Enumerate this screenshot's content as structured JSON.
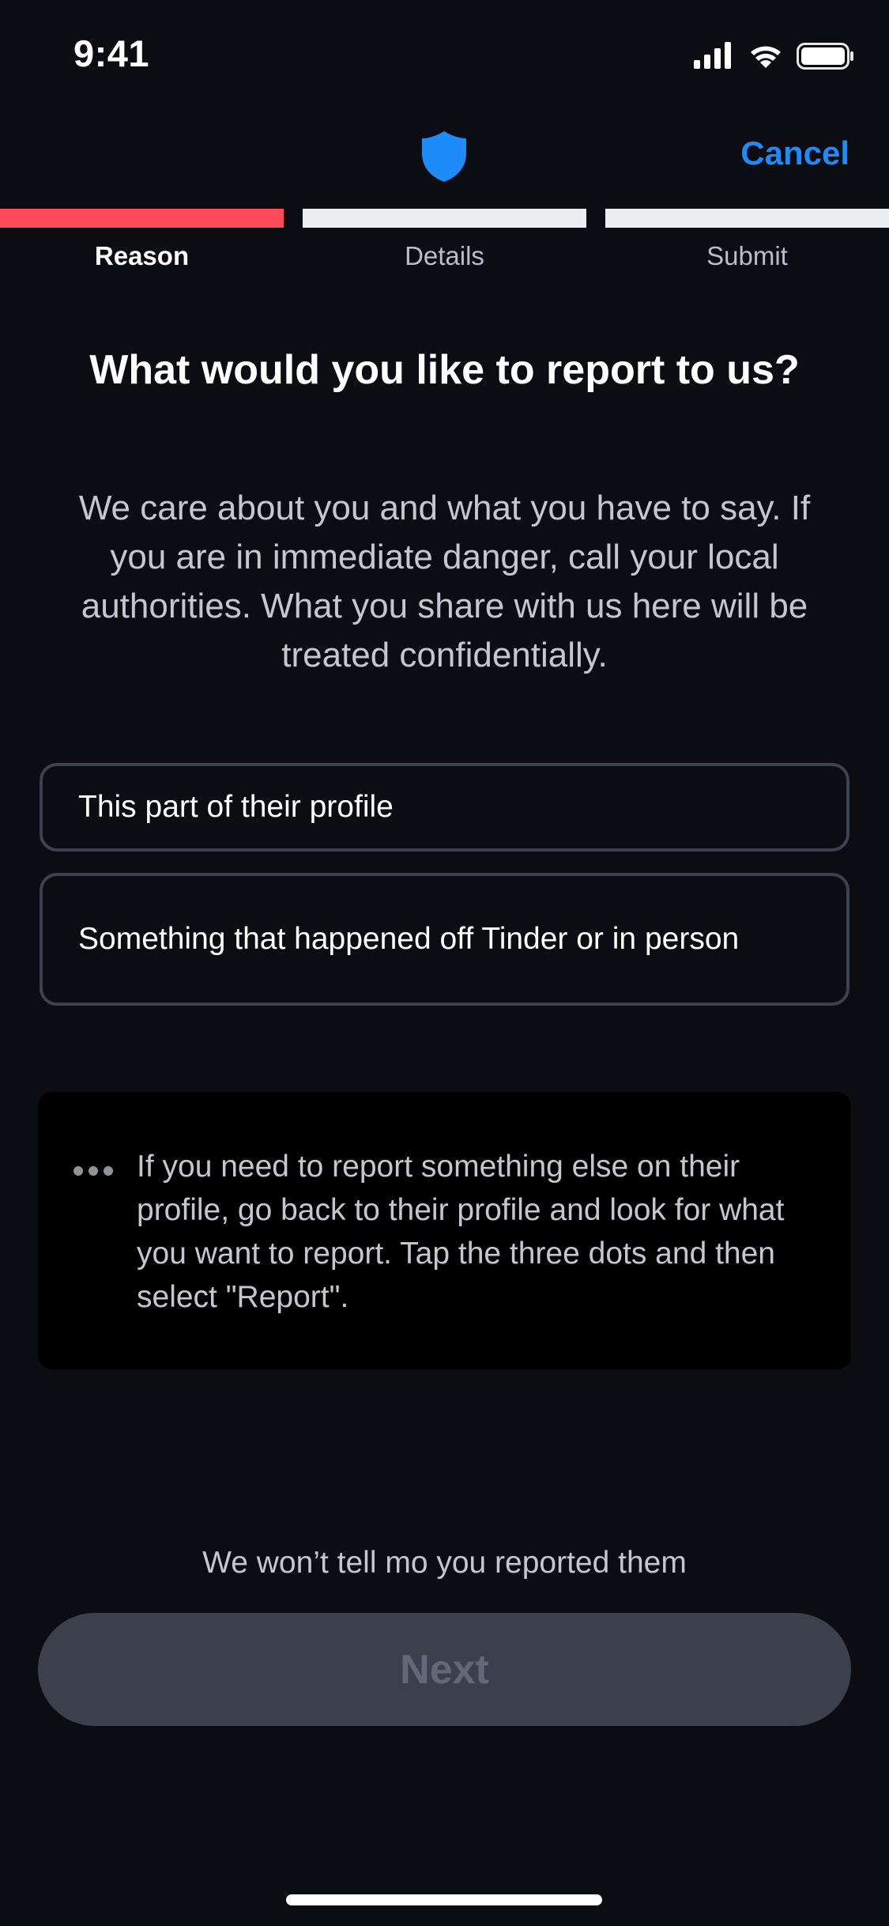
{
  "status_bar": {
    "time": "9:41",
    "icons": [
      "cellular-signal-icon",
      "wifi-icon",
      "battery-icon"
    ]
  },
  "header": {
    "icon": "shield-icon",
    "cancel_label": "Cancel"
  },
  "progress": {
    "steps": [
      {
        "label": "Reason",
        "active": true
      },
      {
        "label": "Details",
        "active": false
      },
      {
        "label": "Submit",
        "active": false
      }
    ]
  },
  "content": {
    "title": "What would you like to report to us?",
    "description": "We care about you and what you have to say. If you are in immediate danger, call your local authorities. What you share with us here will be treated confidentially.",
    "options": [
      {
        "label": "This part of their profile"
      },
      {
        "label": "Something that happened off Tinder or in person"
      }
    ],
    "info": {
      "icon": "more-dots-icon",
      "text": "If you need to report something else on their profile, go back to their profile and look for what you want to report. Tap the three dots and then select \"Report\"."
    }
  },
  "footer": {
    "note": "We won’t tell mo you reported them",
    "next_label": "Next"
  },
  "colors": {
    "background": "#0b0d12",
    "accent_blue": "#1d8cf8",
    "progress_active": "#fd4a5c",
    "progress_inactive": "#ecedf0",
    "button_disabled_bg": "#3b404c",
    "button_disabled_text": "#626875"
  }
}
